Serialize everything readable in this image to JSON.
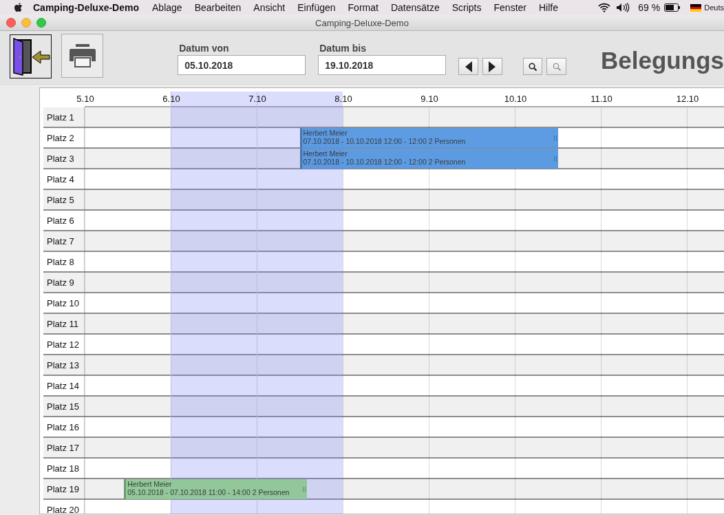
{
  "menubar": {
    "app_name": "Camping-Deluxe-Demo",
    "menus": [
      "Ablage",
      "Bearbeiten",
      "Ansicht",
      "Einfügen",
      "Format",
      "Datensätze",
      "Scripts",
      "Fenster",
      "Hilfe"
    ],
    "battery": "69 %",
    "language": "Deuts"
  },
  "window": {
    "title": "Camping-Deluxe-Demo"
  },
  "toolbar": {
    "date_from": {
      "label": "Datum von",
      "value": "05.10.2018"
    },
    "date_to": {
      "label": "Datum bis",
      "value": "19.10.2018"
    },
    "heading": "Belegungs"
  },
  "timeline": {
    "days": [
      {
        "label": "5.10",
        "selected": false
      },
      {
        "label": "6.10",
        "selected": true
      },
      {
        "label": "7.10",
        "selected": true
      },
      {
        "label": "8.10",
        "selected": false
      },
      {
        "label": "9.10",
        "selected": false
      },
      {
        "label": "10.10",
        "selected": false
      },
      {
        "label": "11.10",
        "selected": false
      },
      {
        "label": "12.10",
        "selected": false
      }
    ],
    "rows": [
      {
        "label": "Platz 1",
        "bookings": []
      },
      {
        "label": "Platz 2",
        "bookings": [
          {
            "name": "Herbert Meier",
            "period": "07.10.2018 - 10.10.2018 12:00 - 12:00 2 Personen",
            "color": "#5597e2"
          }
        ]
      },
      {
        "label": "Platz 3",
        "bookings": [
          {
            "name": "Herbert Meier",
            "period": "07.10.2018 - 10.10.2018 12:00 - 12:00 2 Personen",
            "color": "#5597e2"
          }
        ]
      },
      {
        "label": "Platz 4",
        "bookings": []
      },
      {
        "label": "Platz 5",
        "bookings": []
      },
      {
        "label": "Platz 6",
        "bookings": []
      },
      {
        "label": "Platz 7",
        "bookings": []
      },
      {
        "label": "Platz 8",
        "bookings": []
      },
      {
        "label": "Platz 9",
        "bookings": []
      },
      {
        "label": "Platz 10",
        "bookings": []
      },
      {
        "label": "Platz 11",
        "bookings": []
      },
      {
        "label": "Platz 12",
        "bookings": []
      },
      {
        "label": "Platz 13",
        "bookings": []
      },
      {
        "label": "Platz 14",
        "bookings": []
      },
      {
        "label": "Platz 15",
        "bookings": []
      },
      {
        "label": "Platz 16",
        "bookings": []
      },
      {
        "label": "Platz 17",
        "bookings": []
      },
      {
        "label": "Platz 18",
        "bookings": []
      },
      {
        "label": "Platz 19",
        "bookings": [
          {
            "name": "Herbert Meier",
            "period": "05.10.2018 - 07.10.2018 11:00 - 14:00 2 Personen",
            "color": "#8ec795"
          }
        ]
      },
      {
        "label": "Platz 20",
        "bookings": []
      }
    ]
  }
}
